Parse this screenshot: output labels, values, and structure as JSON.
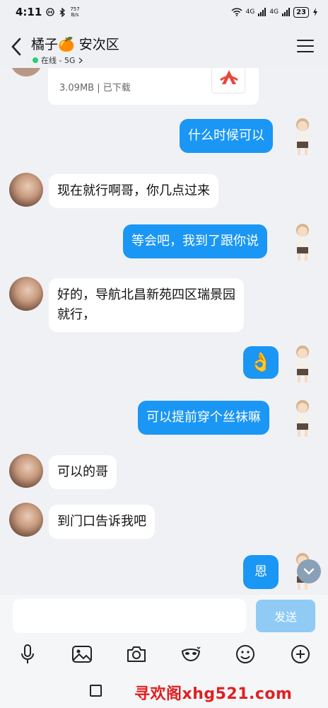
{
  "statusbar": {
    "time": "4:11",
    "speed_value": "757",
    "speed_unit": "B/s",
    "network": "4G",
    "network2": "4G",
    "battery": "23"
  },
  "header": {
    "contact_name": "橘子🍊 安次区",
    "online_status": "在线 - 5G"
  },
  "file_message": {
    "meta": "3.09MB | 已下载"
  },
  "messages": [
    {
      "dir": "out",
      "text": "什么时候可以"
    },
    {
      "dir": "in",
      "text": "现在就行啊哥，你几点过来"
    },
    {
      "dir": "out",
      "text": "等会吧，我到了跟你说"
    },
    {
      "dir": "in",
      "text_line1": "好的，导航北昌新苑四区瑞景园",
      "text_line2": "就行，"
    },
    {
      "dir": "out",
      "emoji": "👌"
    },
    {
      "dir": "out",
      "text": "可以提前穿个丝袜嘛"
    },
    {
      "dir": "in",
      "text": "可以的哥"
    },
    {
      "dir": "in",
      "text": "到门口告诉我吧"
    },
    {
      "dir": "out",
      "text": "恩"
    }
  ],
  "input": {
    "value": "",
    "placeholder": "",
    "send_label": "发送"
  },
  "toolbar_icons": [
    "microphone-icon",
    "image-icon",
    "camera-icon",
    "mask-icon",
    "emoji-icon",
    "plus-icon"
  ],
  "watermark": "寻欢阁xhg521.com",
  "colors": {
    "outgoing_bubble": "#1a96f5",
    "incoming_bubble": "#ffffff",
    "send_button": "#8fcbf5",
    "online_dot": "#2ecc71",
    "watermark": "#e02020"
  }
}
